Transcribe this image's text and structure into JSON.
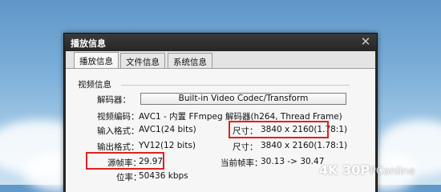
{
  "dialog": {
    "title": "播放信息",
    "tabs": [
      {
        "label": "播放信息"
      },
      {
        "label": "文件信息"
      },
      {
        "label": "系统信息"
      }
    ],
    "group_title": "视频信息",
    "decoder_label": "解码器：",
    "decoder_value": "Built-in Video Codec/Transform",
    "codec_label": "视频编码：",
    "codec_value": "AVC1 - 内置 FFmpeg 解码器(h264, Thread Frame)",
    "input_label": "输入格式：",
    "input_value": "AVC1(24 bits)",
    "input_size_label": "尺寸：",
    "input_size_value": "3840 x 2160(1.78:1)",
    "output_label": "输出格式：",
    "output_value": "YV12(12 bits)",
    "output_size_label": "尺寸：",
    "output_size_value": "3840 x 2160(1.78:1)",
    "framerate_label": "源帧率：",
    "framerate_value": "29.97",
    "current_fps_label": "当前帧率：",
    "current_fps_value": "30.13 -> 30.47",
    "bitrate_label": "位率：",
    "bitrate_value": "50436 kbps"
  },
  "watermark": {
    "main": "4K 30P",
    "sub": "PConline"
  },
  "colors": {
    "highlight": "#e02020",
    "titlebar": "#2b2b2b"
  }
}
